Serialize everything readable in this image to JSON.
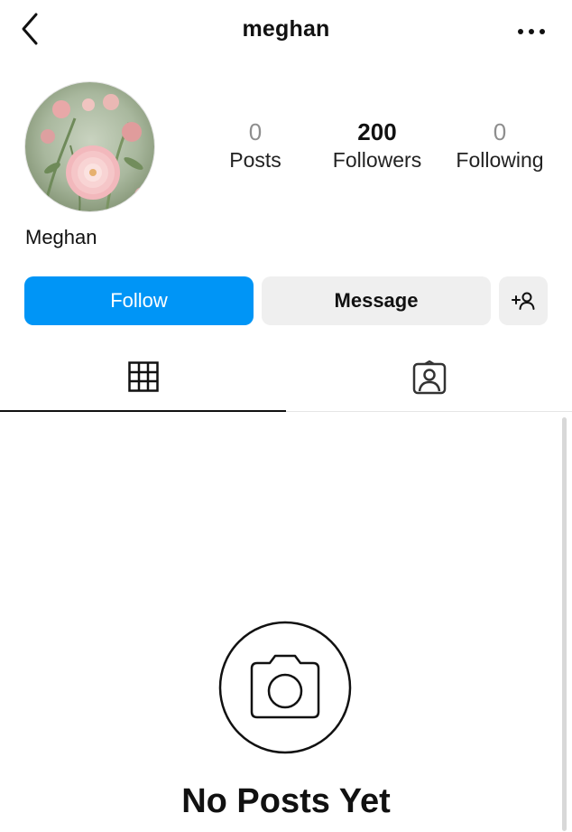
{
  "header": {
    "username": "meghan"
  },
  "profile": {
    "display_name": "Meghan",
    "stats": {
      "posts": {
        "count": "0",
        "label": "Posts"
      },
      "followers": {
        "count": "200",
        "label": "Followers"
      },
      "following": {
        "count": "0",
        "label": "Following"
      }
    }
  },
  "actions": {
    "follow_label": "Follow",
    "message_label": "Message",
    "add_user_glyph": "+"
  },
  "tabs": [
    {
      "name": "posts-grid",
      "icon": "grid-icon",
      "active": true
    },
    {
      "name": "tagged",
      "icon": "tagged-user-icon",
      "active": false
    }
  ],
  "empty_state": {
    "icon": "camera-icon",
    "title": "No Posts Yet"
  },
  "colors": {
    "accent": "#0095f6",
    "button_secondary": "#efefef",
    "muted_count": "#8e8e8e"
  }
}
